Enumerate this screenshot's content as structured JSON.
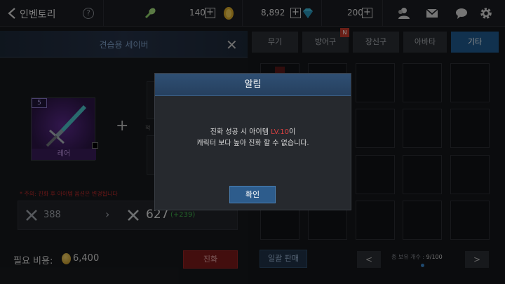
{
  "header": {
    "title": "인벤토리",
    "help_label": "?",
    "resources": [
      {
        "icon": "stamina-icon",
        "value": "140"
      },
      {
        "icon": "gold-coin-icon",
        "value": "8,892"
      },
      {
        "icon": "diamond-icon",
        "value": "200"
      }
    ],
    "plus_label": "+"
  },
  "left": {
    "item_name": "견습용 세이버",
    "close_label": "✕",
    "item_level": "5",
    "item_rarity": "레어",
    "add_sign": "+",
    "slot_hint": "적",
    "warning": "* 주의: 진화 후 아이템 옵션은 변경됩니다",
    "stat_old": "388",
    "stat_arrow": "›",
    "stat_new": "627",
    "stat_diff": "(+239)",
    "cost_label": "필요 비용:",
    "cost_value": "6,400",
    "evolve_label": "진화"
  },
  "tabs": [
    {
      "label": "무기"
    },
    {
      "label": "방어구"
    },
    {
      "label": "장신구"
    },
    {
      "label": "아바타"
    },
    {
      "label": "기타"
    }
  ],
  "tab_badge": "N",
  "active_tab": "기타",
  "right": {
    "sell_all_label": "일괄 판매",
    "hold_label": "총 보유 개수 :",
    "hold_count": "9/100",
    "prev_label": "<",
    "next_label": ">"
  },
  "modal": {
    "title": "알림",
    "line1_a": "진화 성공 시 아이템 ",
    "line1_level": "LV.10",
    "line1_b": "이",
    "line2": "캐릭터 보다 높아 진화 할 수 없습니다.",
    "confirm_label": "확인"
  },
  "colors": {
    "accent_blue": "#1f5a8e",
    "danger_red": "#7a1a1a",
    "level_red": "#d94040",
    "stat_up_green": "#3fae4a",
    "rare_purple": "#5a2a8c"
  }
}
